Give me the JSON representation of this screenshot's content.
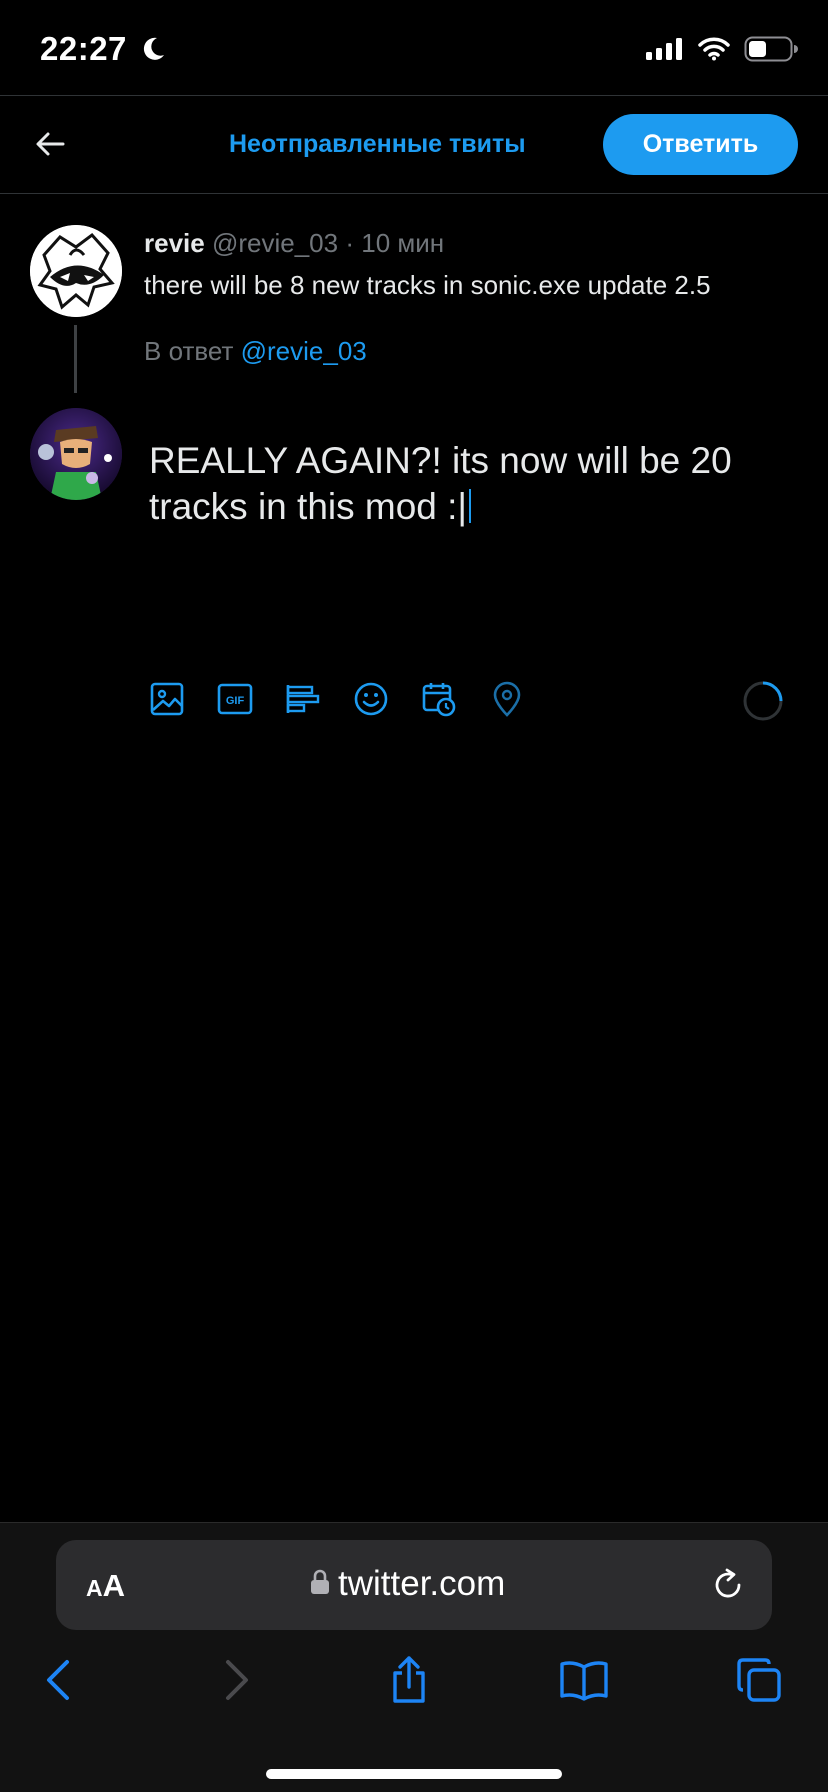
{
  "status_bar": {
    "time": "22:27",
    "icons": [
      "moon-icon",
      "signal-icon",
      "wifi-icon",
      "battery-icon"
    ]
  },
  "header": {
    "back_icon": "arrow-left-icon",
    "drafts_label": "Неотправленные твиты",
    "reply_button_label": "Ответить"
  },
  "original_tweet": {
    "author_name": "revie",
    "handle": "@revie_03",
    "separator": "·",
    "time": "10 мин",
    "text": "there will be 8 new tracks in sonic.exe update 2.5",
    "reply_prefix": "В ответ",
    "reply_mention": "@revie_03"
  },
  "compose": {
    "text": "REALLY AGAIN?! its now will be 20 tracks in this mod :|",
    "toolbar": [
      "image-icon",
      "gif-icon",
      "poll-icon",
      "emoji-icon",
      "schedule-icon",
      "location-icon"
    ]
  },
  "browser": {
    "text_size_small": "A",
    "text_size_big": "A",
    "url": "twitter.com",
    "nav": [
      "back-icon",
      "forward-icon",
      "share-icon",
      "bookmarks-icon",
      "tabs-icon"
    ]
  },
  "colors": {
    "accent": "#1d9bf0",
    "background": "#000000",
    "text": "#e7e9ea",
    "secondary_text": "#71767b",
    "divider": "#2f3336"
  }
}
